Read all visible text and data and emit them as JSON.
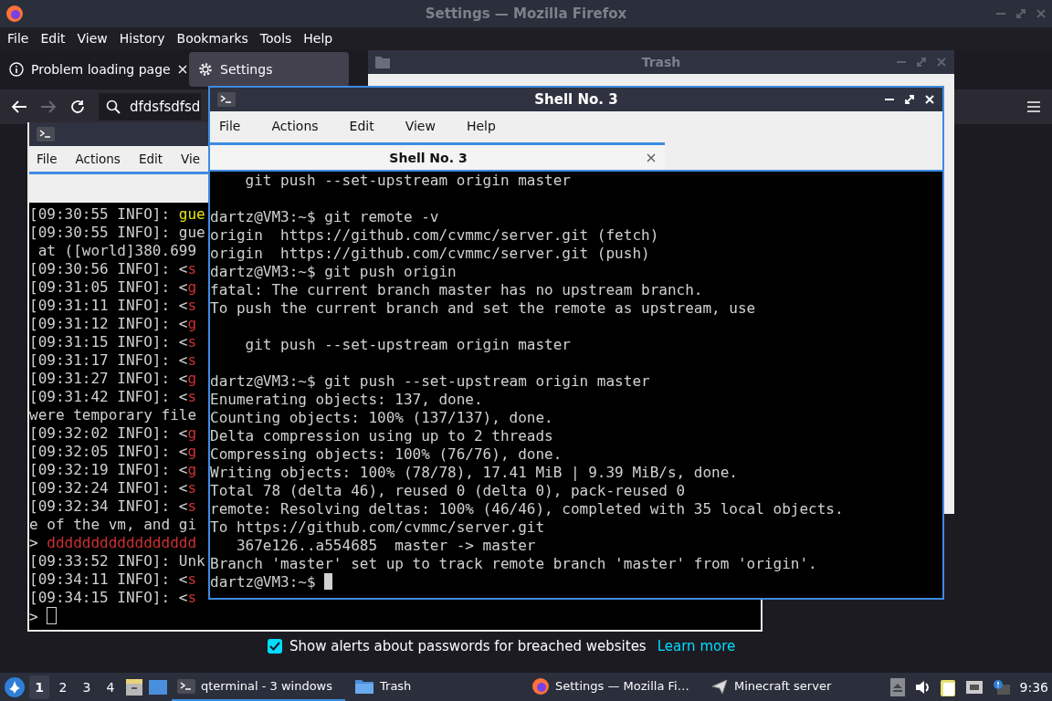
{
  "firefox": {
    "title": "Settings — Mozilla Firefox",
    "menu": [
      "File",
      "Edit",
      "View",
      "History",
      "Bookmarks",
      "Tools",
      "Help"
    ],
    "tabs": [
      {
        "label": "Problem loading page",
        "selected": false,
        "kind": "error"
      },
      {
        "label": "Settings",
        "selected": true,
        "kind": "settings"
      }
    ],
    "url": "dfdsfsdfsd",
    "breach_alerts": {
      "label": "Show alerts about passwords for breached websites",
      "checked": true,
      "link": "Learn more"
    }
  },
  "trash_window": {
    "title": "Trash"
  },
  "server_terminal": {
    "menu": [
      "File",
      "Actions",
      "Edit",
      "Vie"
    ],
    "lines": [
      {
        "text": "[09:30:55 INFO]: ",
        "accent": "gue",
        "color": "#e5e510"
      },
      {
        "text": "[09:30:55 INFO]: gue"
      },
      {
        "text": " at ([world]380.699"
      },
      {
        "text": "[09:30:56 INFO]: <",
        "accent": "s",
        "color": "#cd3131"
      },
      {
        "text": "[09:31:05 INFO]: <",
        "accent": "g",
        "color": "#cd3131"
      },
      {
        "text": "[09:31:11 INFO]: <",
        "accent": "s",
        "color": "#cd3131"
      },
      {
        "text": "[09:31:12 INFO]: <",
        "accent": "g",
        "color": "#cd3131"
      },
      {
        "text": "[09:31:15 INFO]: <",
        "accent": "s",
        "color": "#cd3131"
      },
      {
        "text": "[09:31:17 INFO]: <",
        "accent": "s",
        "color": "#cd3131"
      },
      {
        "text": "[09:31:27 INFO]: <",
        "accent": "g",
        "color": "#cd3131"
      },
      {
        "text": "[09:31:42 INFO]: <",
        "accent": "s",
        "color": "#cd3131"
      },
      {
        "text": "were temporary file"
      },
      {
        "text": "[09:32:02 INFO]: <",
        "accent": "g",
        "color": "#cd3131"
      },
      {
        "text": "[09:32:05 INFO]: <",
        "accent": "g",
        "color": "#cd3131"
      },
      {
        "text": "[09:32:19 INFO]: <",
        "accent": "g",
        "color": "#cd3131"
      },
      {
        "text": "[09:32:24 INFO]: <",
        "accent": "s",
        "color": "#cd3131"
      },
      {
        "text": "[09:32:34 INFO]: <",
        "accent": "s",
        "color": "#cd3131"
      },
      {
        "text": "e of the vm, and gi"
      },
      {
        "text": "> ",
        "accent": "ddddddddddddddddd",
        "color": "#cd3131"
      },
      {
        "text": "[09:33:52 INFO]: Unk"
      },
      {
        "text": "[09:34:11 INFO]: <",
        "accent": "s",
        "color": "#cd3131"
      },
      {
        "text": "[09:34:15 INFO]: <",
        "accent": "s",
        "color": "#cd3131"
      },
      {
        "text": "> ",
        "cursor": true
      }
    ]
  },
  "shell_window": {
    "title": "Shell No. 3",
    "menu": [
      "File",
      "Actions",
      "Edit",
      "View",
      "Help"
    ],
    "tab": "Shell No. 3",
    "lines": [
      {
        "text": "    git push --set-upstream origin master",
        "blank_before": false
      },
      {
        "text": "dartz@VM3:~$ git remote -v",
        "blank_before": true
      },
      {
        "text": "origin  https://github.com/cvmmc/server.git (fetch)",
        "blank_before": false
      },
      {
        "text": "origin  https://github.com/cvmmc/server.git (push)",
        "blank_before": false
      },
      {
        "text": "dartz@VM3:~$ git push origin",
        "blank_before": false
      },
      {
        "text": "fatal: The current branch master has no upstream branch.",
        "blank_before": false
      },
      {
        "text": "To push the current branch and set the remote as upstream, use",
        "blank_before": false
      },
      {
        "text": "    git push --set-upstream origin master",
        "blank_before": true
      },
      {
        "text": "dartz@VM3:~$ git push --set-upstream origin master",
        "blank_before": true
      },
      {
        "text": "Enumerating objects: 137, done.",
        "blank_before": false
      },
      {
        "text": "Counting objects: 100% (137/137), done.",
        "blank_before": false
      },
      {
        "text": "Delta compression using up to 2 threads",
        "blank_before": false
      },
      {
        "text": "Compressing objects: 100% (76/76), done.",
        "blank_before": false
      },
      {
        "text": "Writing objects: 100% (78/78), 17.41 MiB | 9.39 MiB/s, done.",
        "blank_before": false
      },
      {
        "text": "Total 78 (delta 46), reused 0 (delta 0), pack-reused 0",
        "blank_before": false
      },
      {
        "text": "remote: Resolving deltas: 100% (46/46), completed with 35 local objects.",
        "blank_before": false
      },
      {
        "text": "To https://github.com/cvmmc/server.git",
        "blank_before": false
      },
      {
        "text": "   367e126..a554685  master -> master",
        "blank_before": false
      },
      {
        "text": "Branch 'master' set up to track remote branch 'master' from 'origin'.",
        "blank_before": false
      },
      {
        "text": "dartz@VM3:~$ ",
        "blank_before": false,
        "cursor": true
      }
    ]
  },
  "taskbar": {
    "workspaces": [
      {
        "label": "1",
        "selected": true
      },
      {
        "label": "2",
        "selected": false
      },
      {
        "label": "3",
        "selected": false
      },
      {
        "label": "4",
        "selected": false
      }
    ],
    "tasks": [
      {
        "label": "qterminal - 3 windows",
        "kind": "terminal",
        "selected": true
      },
      {
        "label": "Trash",
        "kind": "folder",
        "selected": false
      },
      {
        "label": "Settings — Mozilla Fi…",
        "kind": "browser",
        "selected": false
      },
      {
        "label": "Minecraft server",
        "kind": "app",
        "selected": false
      }
    ],
    "clock": "9:36"
  }
}
